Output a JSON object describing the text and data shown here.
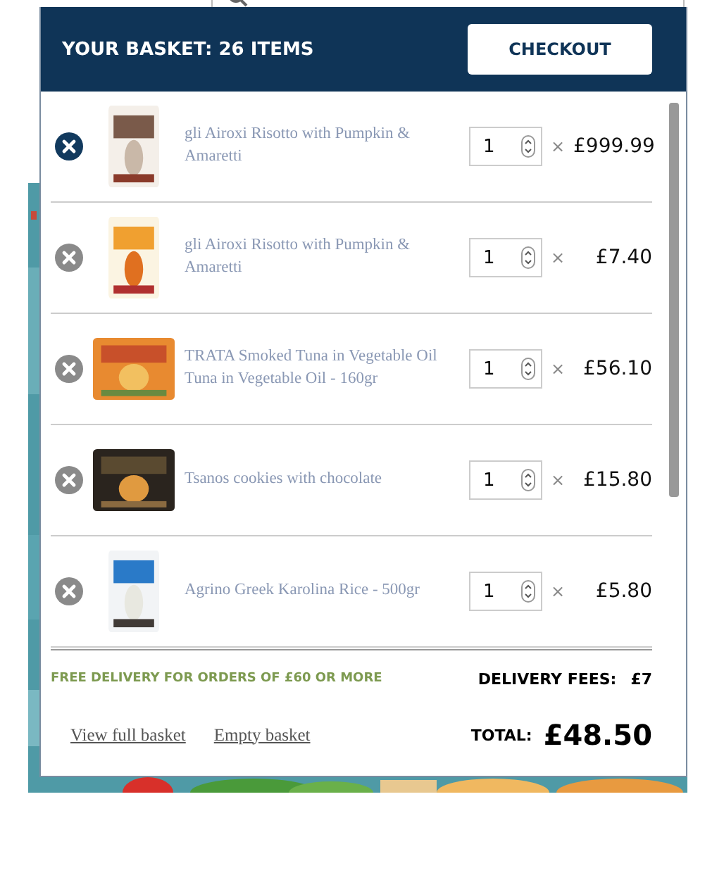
{
  "basket": {
    "title": "YOUR BASKET: 26 ITEMS",
    "checkout": "CHECKOUT",
    "items": [
      {
        "name": "gli Airoxi Risotto with Pumpkin & Amaretti",
        "quantity": "1",
        "times": "×",
        "price": "£999.99",
        "highlighted": true,
        "kind": "picture"
      },
      {
        "name": "gli Airoxi Risotto with Pumpkin & Amaretti",
        "quantity": "1",
        "times": "×",
        "price": "£7.40",
        "highlighted": false,
        "kind": "picture"
      },
      {
        "name": "TRATA Smoked Tuna in Vegetable Oil Tuna in Vegetable Oil - 160gr",
        "quantity": "1",
        "times": "×",
        "price": "£56.10",
        "highlighted": false,
        "kind": "picture"
      },
      {
        "name": "Tsanos cookies with chocolate",
        "quantity": "1",
        "times": "×",
        "price": "£15.80",
        "highlighted": false,
        "kind": "picture"
      },
      {
        "name": "Agrino Greek Karolina Rice - 500gr",
        "quantity": "1",
        "times": "×",
        "price": "£5.80",
        "highlighted": false,
        "kind": "picture"
      }
    ],
    "free_delivery": "FREE DELIVERY FOR ORDERS OF £60 OR MORE",
    "delivery_label": "DELIVERY FEES:",
    "delivery_value": "£7",
    "links": [
      "View full basket",
      "Empty basket"
    ],
    "total_label": "TOTAL:",
    "total_value": "£48.50"
  }
}
